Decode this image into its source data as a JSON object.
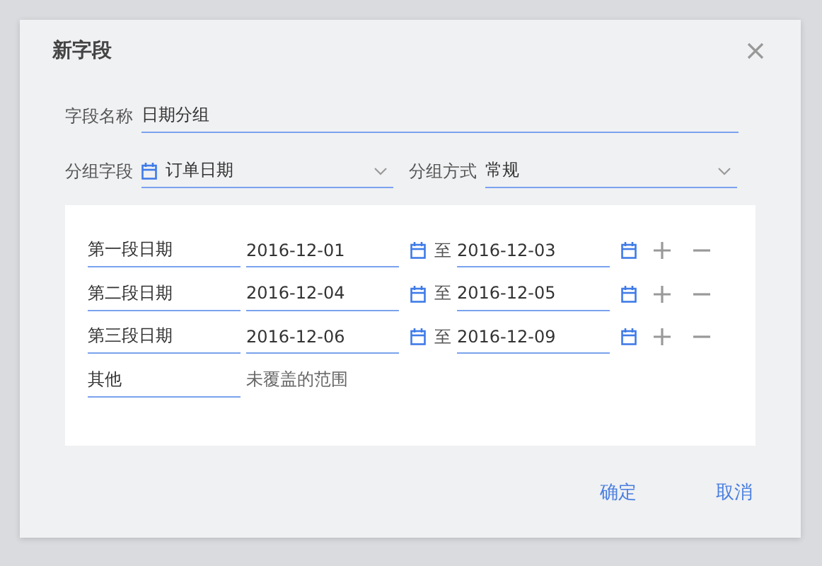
{
  "dialog": {
    "title": "新字段",
    "name_field": {
      "label": "字段名称",
      "value": "日期分组"
    },
    "group_field": {
      "label": "分组字段",
      "value": "订单日期"
    },
    "group_method": {
      "label": "分组方式",
      "value": "常规"
    },
    "ranges": [
      {
        "name": "第一段日期",
        "start": "2016-12-01",
        "separator": "至",
        "end": "2016-12-03"
      },
      {
        "name": "第二段日期",
        "start": "2016-12-04",
        "separator": "至",
        "end": "2016-12-05"
      },
      {
        "name": "第三段日期",
        "start": "2016-12-06",
        "separator": "至",
        "end": "2016-12-09"
      }
    ],
    "other": {
      "name": "其他",
      "note": "未覆盖的范围"
    },
    "buttons": [
      {
        "label": "确定"
      },
      {
        "label": "取消"
      }
    ]
  }
}
